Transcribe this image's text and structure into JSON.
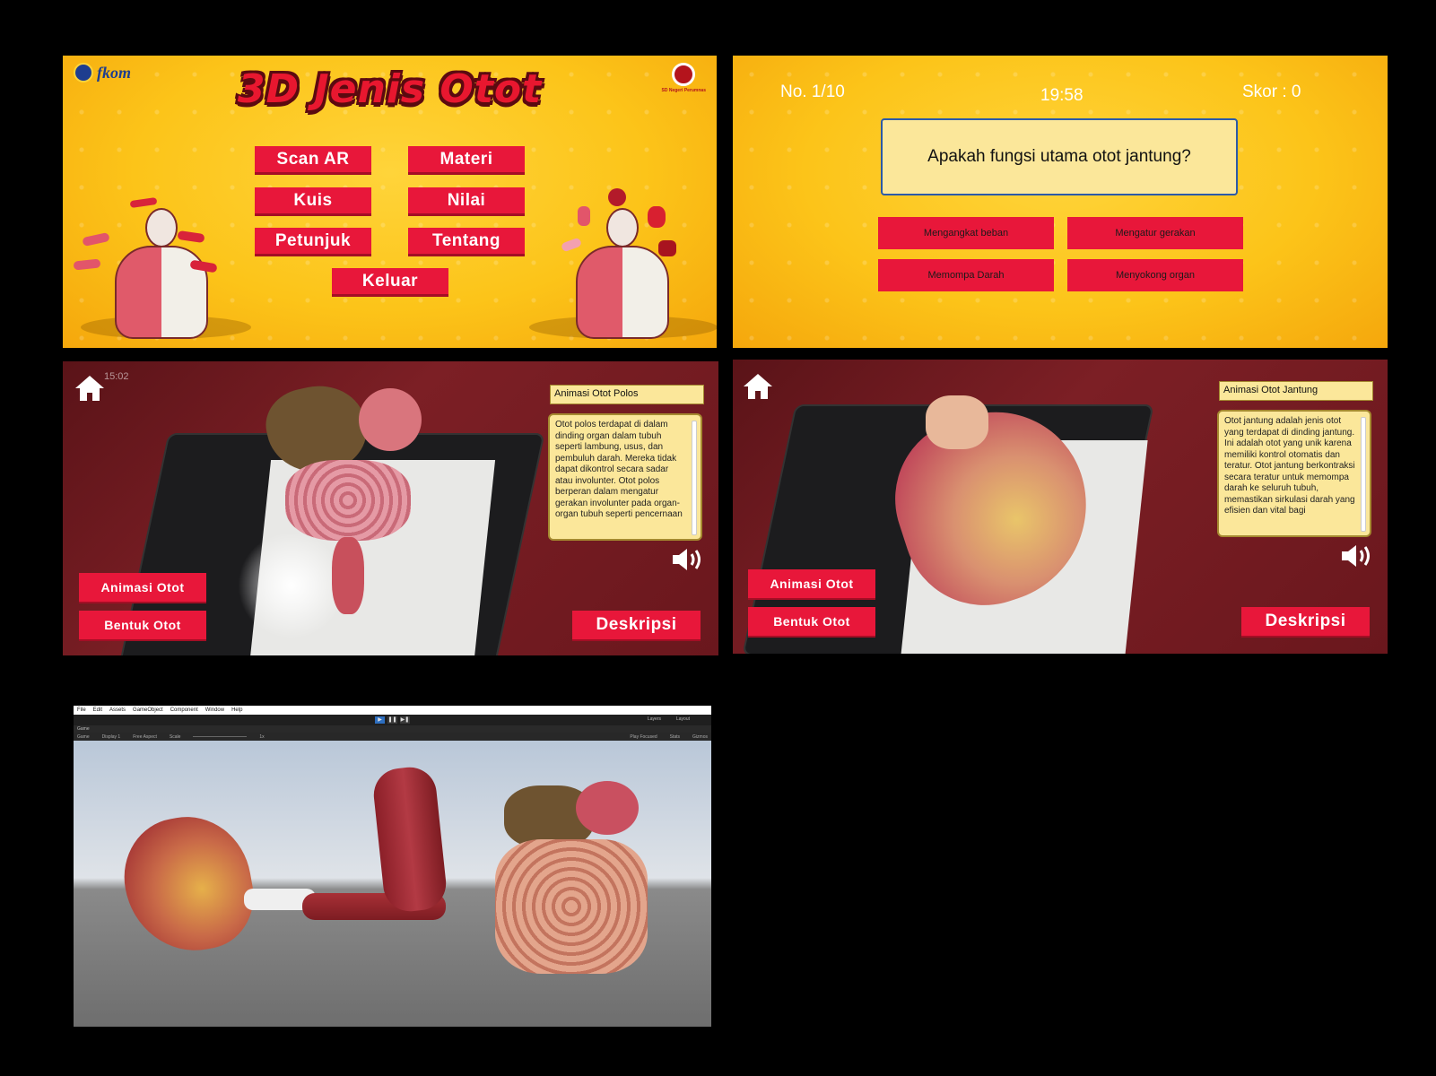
{
  "menu": {
    "logo_text": "fkom",
    "logo_right_caption": "SD Negeri Perumnas",
    "title": "3D Jenis Otot",
    "buttons": {
      "scan_ar": "Scan AR",
      "materi": "Materi",
      "kuis": "Kuis",
      "nilai": "Nilai",
      "petunjuk": "Petunjuk",
      "tentang": "Tentang",
      "keluar": "Keluar"
    }
  },
  "quiz": {
    "number": "No. 1/10",
    "timer": "19:58",
    "score": "Skor : 0",
    "question": "Apakah fungsi utama otot jantung?",
    "answers": [
      "Mengangkat beban",
      "Mengatur gerakan",
      "Memompa Darah",
      "Menyokong organ"
    ]
  },
  "ar_smooth": {
    "status": "15:02",
    "title": "Animasi Otot Polos",
    "description": "Otot polos terdapat di dalam dinding organ dalam tubuh seperti lambung, usus, dan pembuluh darah. Mereka tidak dapat dikontrol secara sadar atau involunter. Otot polos berperan dalam mengatur gerakan involunter pada organ-organ tubuh seperti pencernaan",
    "btn_animasi": "Animasi Otot",
    "btn_bentuk": "Bentuk Otot",
    "btn_deskripsi": "Deskripsi"
  },
  "ar_heart": {
    "title": "Animasi Otot Jantung",
    "description": "Otot jantung adalah jenis otot yang terdapat di dinding jantung. Ini adalah otot yang unik karena memiliki kontrol otomatis dan teratur. Otot jantung berkontraksi secara teratur untuk memompa darah ke seluruh tubuh, memastikan sirkulasi darah yang efisien dan vital bagi",
    "btn_animasi": "Animasi Otot",
    "btn_bentuk": "Bentuk Otot",
    "btn_deskripsi": "Deskripsi"
  },
  "editor": {
    "menu": [
      "File",
      "Edit",
      "Assets",
      "GameObject",
      "Component",
      "Window",
      "Help"
    ],
    "tab": "Game",
    "game_bar": [
      "Game",
      "Display 1",
      "Free Aspect",
      "Scale",
      "1x",
      "Play Focused",
      "Stats",
      "Gizmos"
    ],
    "layers": "Layers",
    "layout": "Layout"
  },
  "colors": {
    "menu_button": "#e8173a",
    "panel_yellow": "#fcc419",
    "title_red": "#e8172f",
    "question_box": "#fbe79a"
  }
}
